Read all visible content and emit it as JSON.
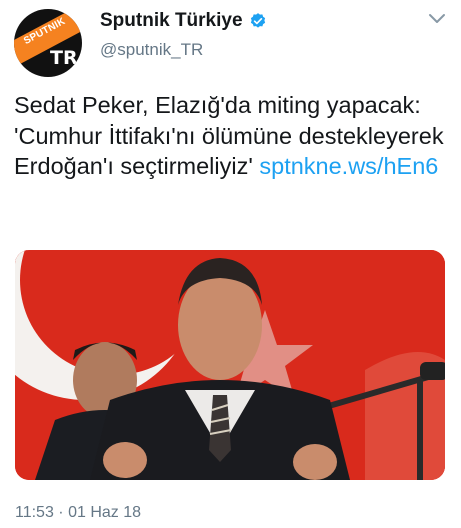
{
  "account": {
    "avatar_brand": "SPUTNIK",
    "avatar_tag": "TR",
    "display_name": "Sputnik Türkiye",
    "handle": "@sputnik_TR",
    "verified_icon": "verified-badge-icon",
    "menu_icon": "chevron-down-icon"
  },
  "tweet": {
    "text": "Sedat Peker, Elazığ'da miting yapacak: 'Cumhur İttifakı'nı ölümüne destekleyerek Erdoğan'ı seçtirmeliyiz'",
    "link": "sptnkne.ws/hEn6",
    "timestamp": "11:53 · 01 Haz 18"
  },
  "colors": {
    "link": "#1da1f2",
    "secondary_text": "#657786",
    "brand_orange": "#f58220",
    "flag_red": "#d92a1c"
  }
}
